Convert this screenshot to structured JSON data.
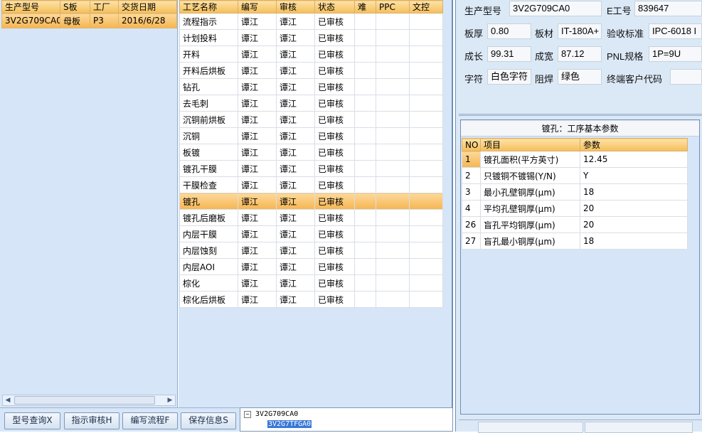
{
  "left": {
    "columns": [
      "生产型号",
      "S板",
      "工厂",
      "交货日期"
    ],
    "rows": [
      [
        "3V2G709CA0",
        "母板",
        "P3",
        "2016/6/28"
      ]
    ]
  },
  "middle": {
    "columns": [
      "工艺名称",
      "编写",
      "审核",
      "状态",
      "难",
      "PPC",
      "文控"
    ],
    "rows": [
      [
        "流程指示",
        "谭江",
        "谭江",
        "已审核"
      ],
      [
        "计划投料",
        "谭江",
        "谭江",
        "已审核"
      ],
      [
        "开料",
        "谭江",
        "谭江",
        "已审核"
      ],
      [
        "开料后烘板",
        "谭江",
        "谭江",
        "已审核"
      ],
      [
        "钻孔",
        "谭江",
        "谭江",
        "已审核"
      ],
      [
        "去毛刺",
        "谭江",
        "谭江",
        "已审核"
      ],
      [
        "沉铜前烘板",
        "谭江",
        "谭江",
        "已审核"
      ],
      [
        "沉铜",
        "谭江",
        "谭江",
        "已审核"
      ],
      [
        "板镀",
        "谭江",
        "谭江",
        "已审核"
      ],
      [
        "镀孔干膜",
        "谭江",
        "谭江",
        "已审核"
      ],
      [
        "干膜检查",
        "谭江",
        "谭江",
        "已审核"
      ],
      [
        "镀孔",
        "谭江",
        "谭江",
        "已审核"
      ],
      [
        "镀孔后磨板",
        "谭江",
        "谭江",
        "已审核"
      ],
      [
        "内层干膜",
        "谭江",
        "谭江",
        "已审核"
      ],
      [
        "内层蚀刻",
        "谭江",
        "谭江",
        "已审核"
      ],
      [
        "内层AOI",
        "谭江",
        "谭江",
        "已审核"
      ],
      [
        "棕化",
        "谭江",
        "谭江",
        "已审核"
      ],
      [
        "棕化后烘板",
        "谭江",
        "谭江",
        "已审核"
      ]
    ],
    "selected_index": 11
  },
  "buttons": {
    "query": "型号查询X",
    "review": "指示审核H",
    "flow": "编写流程F",
    "save": "保存信息S"
  },
  "tree": {
    "root": "3V2G709CA0",
    "child": "3V2G7TFGA0"
  },
  "info": {
    "model_label": "生产型号",
    "model_value": "3V2G709CA0",
    "eno_label": "E工号",
    "eno_value": "839647",
    "thickness_label": "板厚",
    "thickness_value": "0.80",
    "material_label": "板材",
    "material_value": "IT-180A+",
    "standard_label": "验收标准",
    "standard_value": "IPC-6018 I",
    "grow_label": "成长",
    "grow_value": "99.31",
    "width_label": "成宽",
    "width_value": "87.12",
    "pnl_label": "PNL规格",
    "pnl_value": "1P=9U",
    "char_label": "字符",
    "char_value": "白色字符",
    "mask_label": "阻焊",
    "mask_value": "绿色",
    "customer_label": "终端客户代码",
    "customer_value": ""
  },
  "params": {
    "title": "镀孔：工序基本参数",
    "columns": [
      "NO",
      "项目",
      "参数"
    ],
    "rows": [
      [
        "1",
        "镀孔面积(平方英寸)",
        "12.45"
      ],
      [
        "2",
        "只镀铜不镀锡(Y/N)",
        "Y"
      ],
      [
        "3",
        "最小孔壁铜厚(μm)",
        "18"
      ],
      [
        "4",
        "平均孔壁铜厚(μm)",
        "20"
      ],
      [
        "26",
        "盲孔平均铜厚(μm)",
        "20"
      ],
      [
        "27",
        "盲孔最小铜厚(μm)",
        "18"
      ]
    ]
  },
  "colors": {
    "header_orange": "#f5bf58",
    "panel_blue": "#d6e6f8",
    "selection": "#f6b552"
  }
}
